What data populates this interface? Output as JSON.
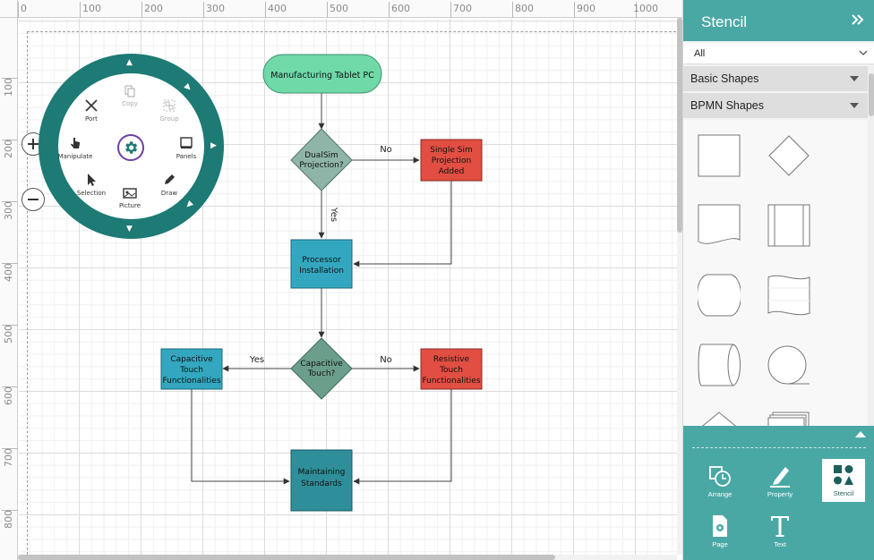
{
  "ruler": {
    "top_labels": [
      "0",
      "100",
      "200",
      "300",
      "400",
      "500",
      "600",
      "700",
      "800",
      "900",
      "1000"
    ],
    "left_labels": [
      "100",
      "200",
      "300",
      "400",
      "500",
      "600",
      "700",
      "800"
    ]
  },
  "diagram": {
    "nodes": {
      "start": "Manufacturing Tablet PC",
      "decision1": [
        "DualSim",
        "Projection?"
      ],
      "single_sim": [
        "Single Sim",
        "Projection",
        "Added"
      ],
      "processor": [
        "Processor",
        "Installation"
      ],
      "decision2": [
        "Capacitive",
        "Touch?"
      ],
      "capacitive": [
        "Capacitive",
        "Touch",
        "Functionalities"
      ],
      "resistive": [
        "Resistive",
        "Touch",
        "Functionalities"
      ],
      "maintaining": [
        "Maintaining",
        "Standards"
      ]
    },
    "edge_labels": {
      "d1_no": "No",
      "d1_yes": "Yes",
      "d2_yes": "Yes",
      "d2_no": "No"
    },
    "colors": {
      "start_fill": "#6fd9a8",
      "decision_fill": "#8fb5a8",
      "red_fill": "#e24e42",
      "teal_fill": "#33a7c0",
      "dark_teal_fill": "#2e8e99",
      "decision2_fill": "#6c9e8c"
    }
  },
  "radial_menu": {
    "items": {
      "port": "Port",
      "copy": "Copy",
      "group": "Group",
      "manipulate": "Manipulate",
      "panels": "Panels",
      "selection": "Selection",
      "draw": "Draw",
      "picture": "Picture"
    },
    "ring_color": "#1d7a74",
    "center_icon": "gear-icon"
  },
  "stencil": {
    "title": "Stencil",
    "filter_value": "All",
    "categories": [
      "Basic Shapes",
      "BPMN Shapes"
    ]
  },
  "toolbar": {
    "buttons": [
      "Arrange",
      "Property",
      "Stencil",
      "Page",
      "Text"
    ],
    "active": "Stencil"
  },
  "theme": {
    "accent": "#4aa8a4"
  }
}
